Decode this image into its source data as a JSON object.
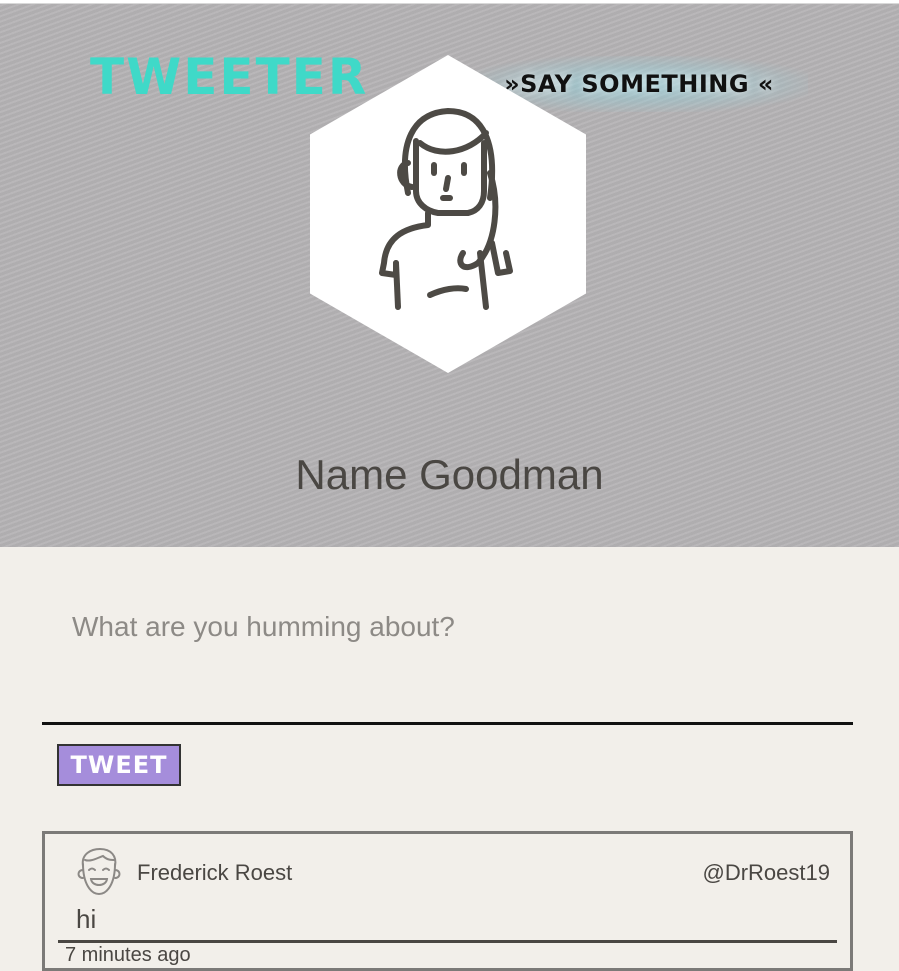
{
  "header": {
    "brand": "TWEETER",
    "tagline": "»SAY SOMETHING «"
  },
  "profile": {
    "avatar_icon": "woman-avatar-icon",
    "name": "Name Goodman"
  },
  "composer": {
    "placeholder": "What are you humming about?",
    "value": "",
    "submit_label": "TWEET"
  },
  "tweets": [
    {
      "avatar_icon": "smiling-man-avatar-icon",
      "author": "Frederick Roest",
      "handle": "@DrRoest19",
      "text": "hi",
      "time": "7 minutes ago"
    }
  ],
  "colors": {
    "brand": "#3fd9c8",
    "hero_bg": "#b5b3b5",
    "page_bg": "#f2efea",
    "button": "#a58ddb"
  }
}
